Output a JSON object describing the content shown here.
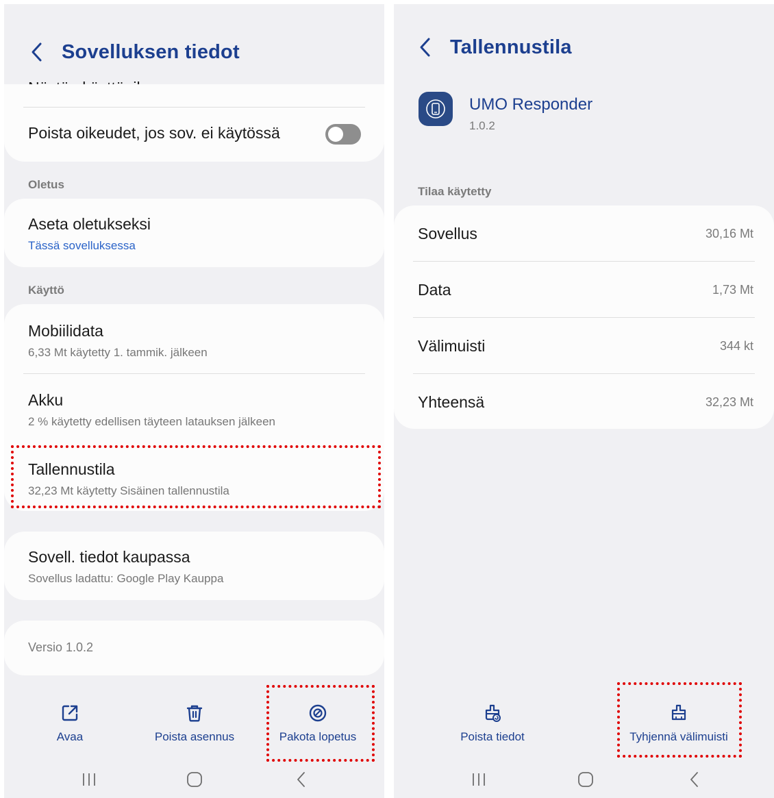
{
  "left": {
    "header": {
      "title": "Sovelluksen tiedot"
    },
    "clipped_row": "Näytön käyttöaika",
    "permissions_row": {
      "label": "Poista oikeudet, jos sov. ei käytössä",
      "enabled": false
    },
    "default_section": "Oletus",
    "default_row": {
      "title": "Aseta oletukseksi",
      "subtitle": "Tässä sovelluksessa"
    },
    "usage_section": "Käyttö",
    "mobile_data": {
      "title": "Mobiilidata",
      "subtitle": "6,33 Mt käytetty 1. tammik. jälkeen"
    },
    "battery": {
      "title": "Akku",
      "subtitle": "2 % käytetty edellisen täyteen latauksen jälkeen"
    },
    "storage": {
      "title": "Tallennustila",
      "subtitle": "32,23 Mt käytetty Sisäinen tallennustila"
    },
    "store": {
      "title": "Sovell. tiedot kaupassa",
      "subtitle": "Sovellus ladattu: Google Play Kauppa"
    },
    "version": "Versio 1.0.2",
    "actions": {
      "open": "Avaa",
      "uninstall": "Poista asennus",
      "force_stop": "Pakota lopetus"
    }
  },
  "right": {
    "header": {
      "title": "Tallennustila"
    },
    "app": {
      "name": "UMO Responder",
      "version": "1.0.2"
    },
    "section": "Tilaa käytetty",
    "rows": [
      {
        "label": "Sovellus",
        "value": "30,16 Mt"
      },
      {
        "label": "Data",
        "value": "1,73 Mt"
      },
      {
        "label": "Välimuisti",
        "value": "344 kt"
      },
      {
        "label": "Yhteensä",
        "value": "32,23 Mt"
      }
    ],
    "actions": {
      "clear_data": "Poista tiedot",
      "clear_cache": "Tyhjennä välimuisti"
    }
  },
  "colors": {
    "accent": "#1c3f8f",
    "link": "#2a63c8",
    "highlight": "#e00000",
    "background": "#f0f0f3"
  },
  "icons": [
    "chevron-left-icon",
    "external-link-icon",
    "trash-icon",
    "stop-circle-icon",
    "brush-icon",
    "recent-apps-icon",
    "home-icon",
    "back-icon"
  ]
}
